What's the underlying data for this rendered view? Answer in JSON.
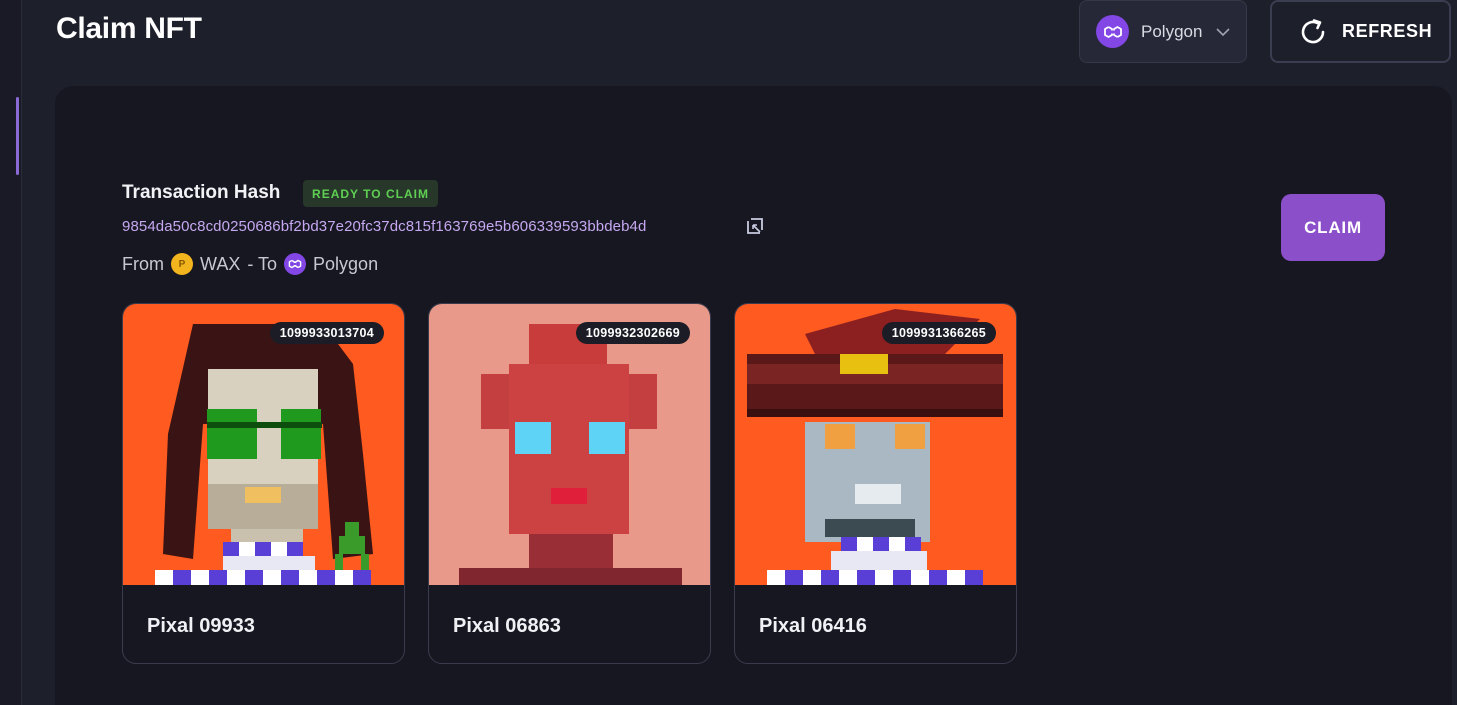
{
  "page": {
    "title": "Claim NFT"
  },
  "network_select": {
    "selected": "Polygon",
    "icon": "polygon-icon"
  },
  "refresh": {
    "label": "REFRESH",
    "icon": "refresh-icon"
  },
  "transaction": {
    "title": "Transaction Hash",
    "status": "READY TO CLAIM",
    "hash": "9854da50c8cd0250686bf2bd37e20fc37dc815f163769e5b606339593bbdeb4d",
    "route": {
      "from_label": "From",
      "from_chain": "WAX",
      "separator": "- To",
      "to_chain": "Polygon"
    },
    "claim_label": "CLAIM"
  },
  "nfts": [
    {
      "id": "1099933013704",
      "name": "Pixal 09933",
      "bg": "#ff5a1f"
    },
    {
      "id": "1099932302669",
      "name": "Pixal 06863",
      "bg": "#e8998a"
    },
    {
      "id": "1099931366265",
      "name": "Pixal 06416",
      "bg": "#ff5a1f"
    }
  ],
  "colors": {
    "accent": "#8a4fc9",
    "status_green": "#5fcf53",
    "hash_text": "#c6a8f1",
    "polygon": "#8247e5",
    "wax": "#f2b51d"
  }
}
